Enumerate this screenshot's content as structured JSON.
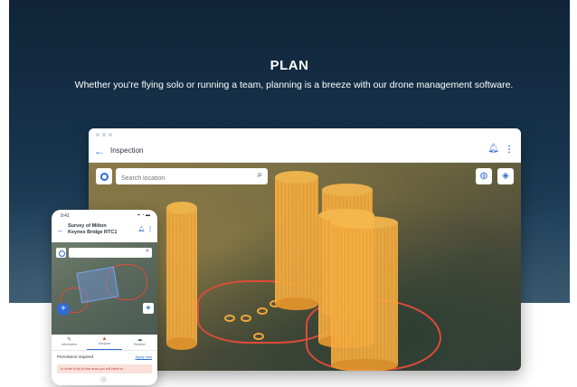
{
  "hero": {
    "title": "PLAN",
    "subtitle": "Whether you're flying solo or running a team, planning is a breeze with our drone management software."
  },
  "desktop": {
    "page_title": "Inspection",
    "search_placeholder": "Search location"
  },
  "phone": {
    "status_time": "9:41",
    "status_icons": "▪▪ ◔ ▬",
    "title": "Survey of Milton Keynes Bridge RTC1",
    "search_placeholder": "Search location",
    "tabs": [
      {
        "label": "Information",
        "icon": "pencil-icon"
      },
      {
        "label": "Airspace",
        "icon": "airspace-icon"
      },
      {
        "label": "Weather",
        "icon": "weather-icon"
      }
    ],
    "permission_label": "Permission required",
    "permission_link": "Apply now",
    "permission_alert": "In order to fly in this area you will need to..."
  },
  "colors": {
    "hero_bg": "#16324a",
    "accent": "#2f6cd6",
    "column": "#f0a63c",
    "restricted_zone": "#e04b3a"
  }
}
